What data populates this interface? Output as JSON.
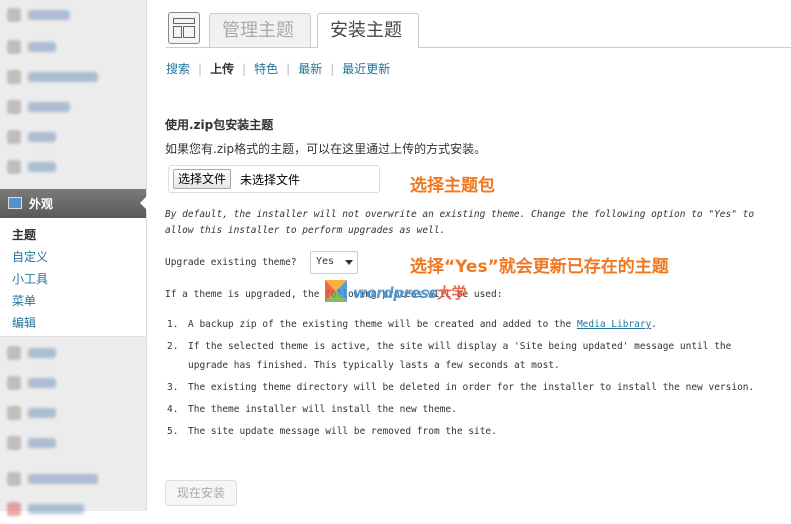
{
  "sidebar": {
    "active": {
      "label": "外观",
      "icon": "appearance-icon"
    },
    "submenu": [
      {
        "label": "主题",
        "current": true
      },
      {
        "label": "自定义",
        "current": false
      },
      {
        "label": "小工具",
        "current": false
      },
      {
        "label": "菜单",
        "current": false
      },
      {
        "label": "编辑",
        "current": false
      }
    ]
  },
  "tabs": [
    {
      "label": "管理主题",
      "active": false
    },
    {
      "label": "安装主题",
      "active": true
    }
  ],
  "subnav": [
    {
      "label": "搜索",
      "current": false
    },
    {
      "label": "上传",
      "current": true
    },
    {
      "label": "特色",
      "current": false
    },
    {
      "label": "最新",
      "current": false
    },
    {
      "label": "最近更新",
      "current": false
    }
  ],
  "upload": {
    "title": "使用.zip包安装主题",
    "description": "如果您有.zip格式的主题，可以在这里通过上传的方式安装。",
    "choose_button": "选择文件",
    "no_file": "未选择文件"
  },
  "note": "By default, the installer will not overwrite an existing theme. Change the following option to \"Yes\" to allow this installer to perform upgrades as well.",
  "upgrade": {
    "label": "Upgrade existing theme?",
    "value": "Yes"
  },
  "process_intro": "If a theme is upgraded, the following process will be used:",
  "steps": [
    {
      "num": "1.",
      "text": "A backup zip of the existing theme will be created and added to the ",
      "link": "Media Library",
      "suffix": "."
    },
    {
      "num": "2.",
      "text": "If the selected theme is active, the site will display a 'Site being updated' message until the upgrade has finished. This typically lasts a few seconds at most."
    },
    {
      "num": "3.",
      "text": "The existing theme directory will be deleted in order for the installer to install the new version."
    },
    {
      "num": "4.",
      "text": "The theme installer will install the new theme."
    },
    {
      "num": "5.",
      "text": "The site update message will be removed from the site."
    }
  ],
  "install_button": "现在安装",
  "annotations": {
    "choose_package": "选择主题包",
    "select_yes": "选择“Yes”就会更新已存在的主题"
  },
  "watermark": {
    "text": "wordpress",
    "cn": "大学"
  },
  "colors": {
    "link": "#21759b",
    "annotation": "#f07820"
  }
}
